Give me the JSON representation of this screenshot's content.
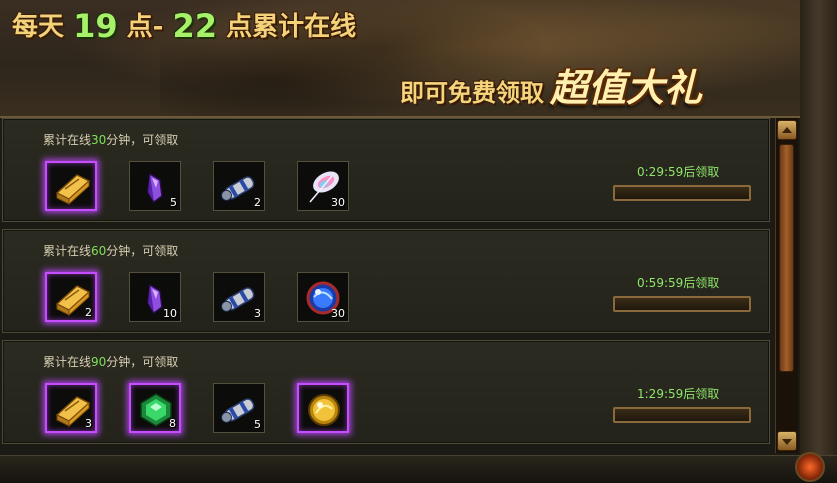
{
  "banner": {
    "prefix": "每天",
    "start_hour": "19",
    "mid": "点-",
    "end_hour": "22",
    "suffix": "点累计在线",
    "subtitle": "即可免费领取",
    "highlight": "超值大礼"
  },
  "rows": [
    {
      "label_pre": "累计在线",
      "minutes": "30",
      "label_post": "分钟，可领取",
      "timer": "0:29:59后领取",
      "progress": 0,
      "items": [
        {
          "icon": "gold-bar-icon",
          "count": "",
          "quality": "purple"
        },
        {
          "icon": "purple-crystal-icon",
          "count": "5",
          "quality": "normal"
        },
        {
          "icon": "scroll-icon",
          "count": "2",
          "quality": "normal"
        },
        {
          "icon": "feather-icon",
          "count": "30",
          "quality": "normal"
        }
      ]
    },
    {
      "label_pre": "累计在线",
      "minutes": "60",
      "label_post": "分钟，可领取",
      "timer": "0:59:59后领取",
      "progress": 0,
      "items": [
        {
          "icon": "gold-bar-icon",
          "count": "2",
          "quality": "purple"
        },
        {
          "icon": "purple-crystal-icon",
          "count": "10",
          "quality": "normal"
        },
        {
          "icon": "scroll-icon",
          "count": "3",
          "quality": "normal"
        },
        {
          "icon": "blue-orb-icon",
          "count": "30",
          "quality": "normal"
        }
      ]
    },
    {
      "label_pre": "累计在线",
      "minutes": "90",
      "label_post": "分钟，可领取",
      "timer": "1:29:59后领取",
      "progress": 0,
      "items": [
        {
          "icon": "gold-bar-icon",
          "count": "3",
          "quality": "purple"
        },
        {
          "icon": "green-gem-icon",
          "count": "8",
          "quality": "purple"
        },
        {
          "icon": "scroll-icon",
          "count": "5",
          "quality": "normal"
        },
        {
          "icon": "gold-orb-icon",
          "count": "",
          "quality": "purple"
        }
      ]
    }
  ]
}
